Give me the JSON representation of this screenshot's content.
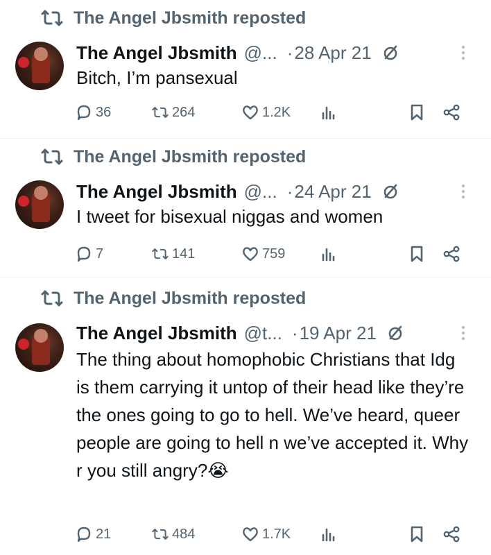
{
  "colors": {
    "text": "#0f1419",
    "muted": "#536471",
    "divider": "#eff3f4"
  },
  "icons": {
    "repost": "repost-icon",
    "edited": "edited-icon",
    "more": "more-icon",
    "reply": "reply-icon",
    "retweet": "retweet-icon",
    "like": "heart-icon",
    "views": "views-icon",
    "bookmark": "bookmark-icon",
    "share": "share-icon"
  },
  "tweets": [
    {
      "repost_name": "The Angel Jbsmith",
      "repost_verb": "reposted",
      "name": "The Angel Jbsmith",
      "handle": "@...",
      "date": "28 Apr 21",
      "text": "Bitch, I’m pansexual",
      "replies": "36",
      "retweets": "264",
      "likes": "1.2K"
    },
    {
      "repost_name": "The Angel Jbsmith",
      "repost_verb": "reposted",
      "name": "The Angel Jbsmith",
      "handle": "@...",
      "date": "24 Apr 21",
      "text": "I tweet for bisexual niggas and women",
      "replies": "7",
      "retweets": "141",
      "likes": "759"
    },
    {
      "repost_name": "The Angel Jbsmith",
      "repost_verb": "reposted",
      "name": "The Angel Jbsmith",
      "handle": "@t...",
      "date": "19 Apr 21",
      "text": "The thing about homophobic Christians that Idg is them carrying it untop of their head like they’re the ones going to go to hell. We’ve heard, queer people are going to hell n we’ve accepted it. Why r you still angry?😭",
      "replies": "21",
      "retweets": "484",
      "likes": "1.7K"
    }
  ]
}
